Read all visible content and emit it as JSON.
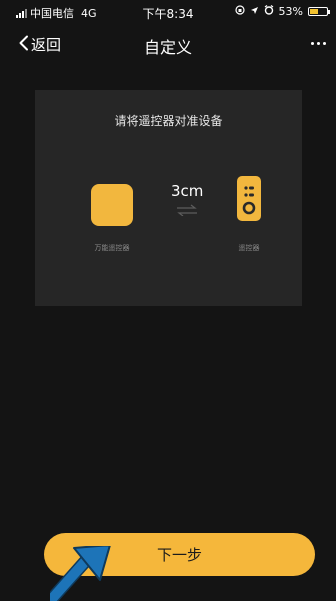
{
  "status_bar": {
    "carrier": "中国电信",
    "network": "4G",
    "time": "下午8:34",
    "battery": "53%",
    "battery_level": 0.53
  },
  "nav": {
    "back_label": "返回",
    "title": "自定义"
  },
  "card": {
    "instruction": "请将遥控器对准设备",
    "distance": "3cm",
    "left_device_label": "万能遥控器",
    "right_device_label": "遥控器"
  },
  "next_button": {
    "label": "下一步"
  },
  "colors": {
    "accent": "#f5b73b",
    "background": "#141414",
    "card": "#262626",
    "pointer_arrow": "#1d74b8"
  }
}
